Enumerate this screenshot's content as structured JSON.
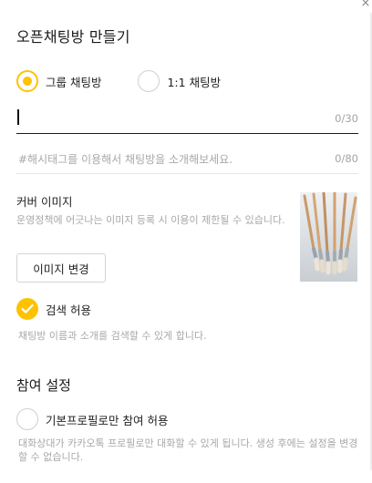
{
  "window": {
    "close_glyph": "×"
  },
  "title": "오픈채팅방 만들기",
  "room_type": {
    "options": [
      {
        "label": "그룹 채팅방",
        "selected": true
      },
      {
        "label": "1:1 채팅방",
        "selected": false
      }
    ]
  },
  "name_input": {
    "value": "",
    "counter": "0/30"
  },
  "hashtag_input": {
    "placeholder": "#해시태그를 이용해서 채팅방을 소개해보세요.",
    "counter": "0/80"
  },
  "cover": {
    "title": "커버 이미지",
    "description": "운영정책에 어긋나는 이미지 등록 시 이용이 제한될 수 있습니다.",
    "change_button": "이미지 변경",
    "image_subject": "paintbrushes"
  },
  "search": {
    "label": "검색 허용",
    "checked": true,
    "description": "채팅방 이름과 소개를 검색할 수 있게 합니다."
  },
  "participation": {
    "section_title": "참여 설정",
    "profile_only_label": "기본프로필로만 참여 허용",
    "profile_only_checked": false,
    "profile_only_description": "대화상대가 카카오톡 프로필로만 대화할 수 있게 됩니다. 생성 후에는 설정을 변경할 수 없습니다."
  },
  "colors": {
    "accent": "#fec300",
    "placeholder": "#a8a8a8",
    "text": "#222222"
  }
}
